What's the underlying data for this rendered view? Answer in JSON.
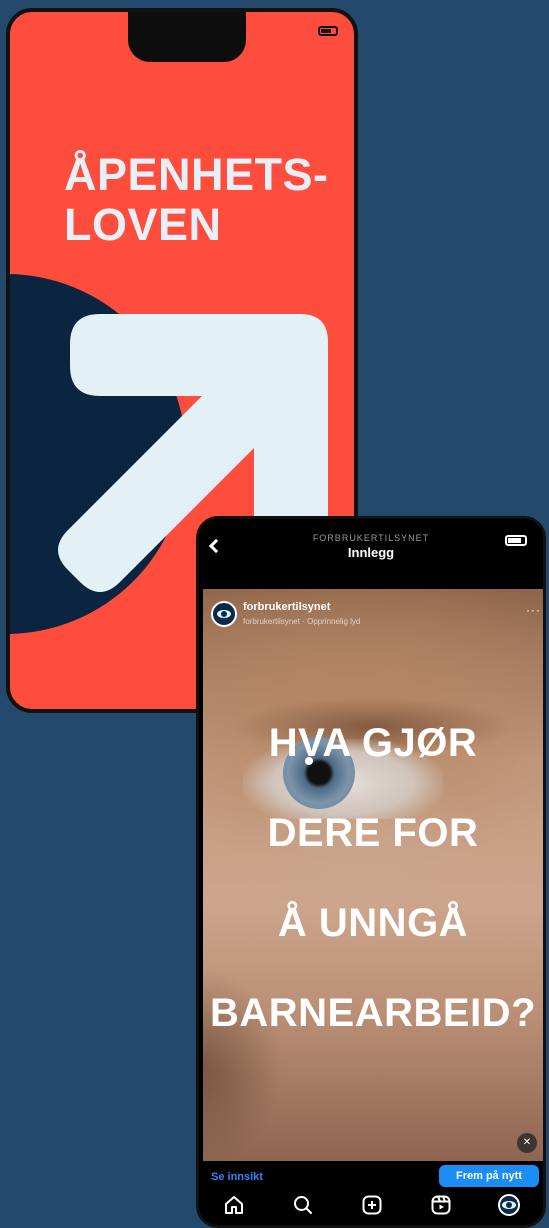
{
  "poster": {
    "title_line1": "ÅPENHETS-",
    "title_line2": "LOVEN",
    "background_color": "#ff4d3d",
    "arrow_color": "#e3f0f6",
    "shape_color": "#0b2540"
  },
  "instagram": {
    "header_account": "FORBRUKERTILSYNET",
    "header_title": "Innlegg",
    "post": {
      "username": "forbrukertilsynet",
      "subtitle": "forbrukertilsynet · Opprinnelig lyd",
      "overlay_lines": [
        "HVA GJØR",
        "DERE FOR",
        "Å UNNGÅ",
        "BARNEARBEID?"
      ]
    },
    "insight_link": "Se innsikt",
    "promote_button": "Frem på nytt",
    "nav": [
      {
        "icon": "home-icon"
      },
      {
        "icon": "search-icon"
      },
      {
        "icon": "add-post-icon"
      },
      {
        "icon": "reels-icon"
      },
      {
        "icon": "profile-avatar-icon"
      }
    ],
    "accent_color": "#1d8df6"
  }
}
